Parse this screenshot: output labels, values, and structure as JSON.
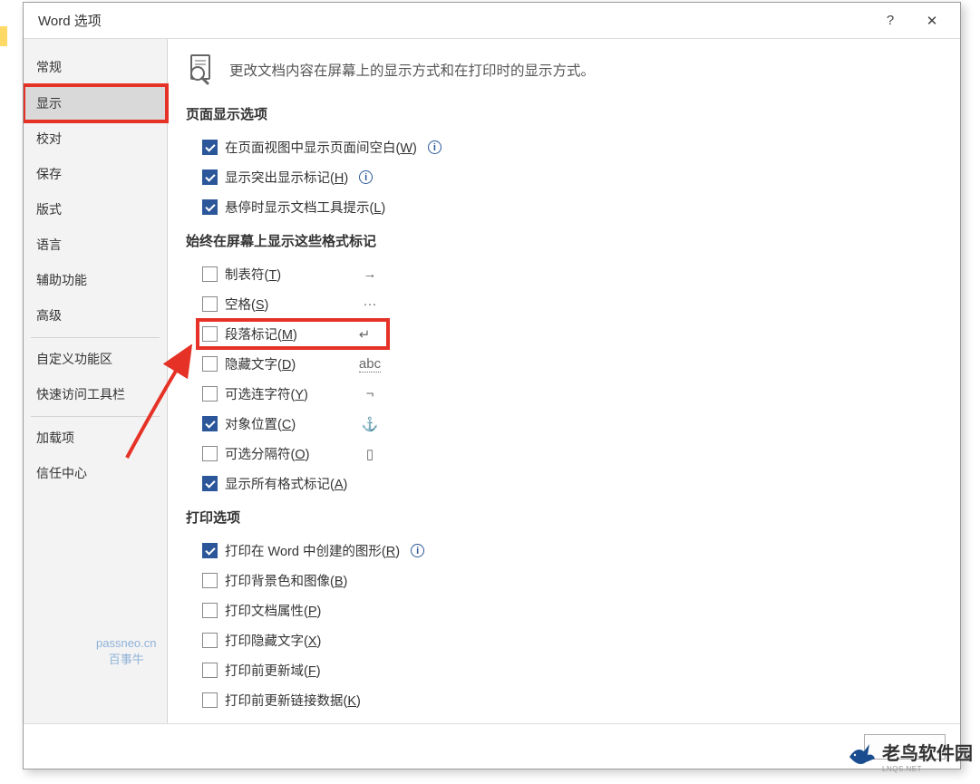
{
  "dialog": {
    "title": "Word 选项",
    "help_tooltip": "?",
    "close_tooltip": "✕"
  },
  "sidebar": {
    "items": [
      {
        "id": "general",
        "label": "常规"
      },
      {
        "id": "display",
        "label": "显示",
        "selected": true,
        "highlighted": true
      },
      {
        "id": "proofing",
        "label": "校对"
      },
      {
        "id": "save",
        "label": "保存"
      },
      {
        "id": "layout",
        "label": "版式"
      },
      {
        "id": "language",
        "label": "语言"
      },
      {
        "id": "accessibility",
        "label": "辅助功能"
      },
      {
        "id": "advanced",
        "label": "高级"
      },
      {
        "id": "customize-ribbon",
        "label": "自定义功能区"
      },
      {
        "id": "quick-access",
        "label": "快速访问工具栏"
      },
      {
        "id": "addins",
        "label": "加载项"
      },
      {
        "id": "trust-center",
        "label": "信任中心"
      }
    ]
  },
  "header": {
    "description": "更改文档内容在屏幕上的显示方式和在打印时的显示方式。"
  },
  "sections": {
    "page_display": {
      "title": "页面显示选项",
      "options": [
        {
          "id": "white-space",
          "label_pre": "在页面视图中显示页面间空白(",
          "hotkey": "W",
          "label_post": ")",
          "checked": true,
          "info": true
        },
        {
          "id": "highlighter",
          "label_pre": "显示突出显示标记(",
          "hotkey": "H",
          "label_post": ")",
          "checked": true,
          "info": true
        },
        {
          "id": "tooltips",
          "label_pre": "悬停时显示文档工具提示(",
          "hotkey": "L",
          "label_post": ")",
          "checked": true,
          "info": false
        }
      ]
    },
    "formatting_marks": {
      "title": "始终在屏幕上显示这些格式标记",
      "options": [
        {
          "id": "tabs",
          "label_pre": "制表符(",
          "hotkey": "T",
          "label_post": ")",
          "checked": false,
          "symbol": "→"
        },
        {
          "id": "spaces",
          "label_pre": "空格(",
          "hotkey": "S",
          "label_post": ")",
          "checked": false,
          "symbol": "···"
        },
        {
          "id": "paragraph",
          "label_pre": "段落标记(",
          "hotkey": "M",
          "label_post": ")",
          "checked": false,
          "symbol": "↵",
          "highlighted": true
        },
        {
          "id": "hidden-text",
          "label_pre": "隐藏文字(",
          "hotkey": "D",
          "label_post": ")",
          "checked": false,
          "symbol": "abc",
          "symbol_underline": true
        },
        {
          "id": "optional-hyphens",
          "label_pre": "可选连字符(",
          "hotkey": "Y",
          "label_post": ")",
          "checked": false,
          "symbol": "¬"
        },
        {
          "id": "object-anchors",
          "label_pre": "对象位置(",
          "hotkey": "C",
          "label_post": ")",
          "checked": true,
          "symbol": "⚓"
        },
        {
          "id": "optional-breaks",
          "label_pre": "可选分隔符(",
          "hotkey": "O",
          "label_post": ")",
          "checked": false,
          "symbol": "▯"
        },
        {
          "id": "show-all",
          "label_pre": "显示所有格式标记(",
          "hotkey": "A",
          "label_post": ")",
          "checked": true,
          "symbol": ""
        }
      ]
    },
    "printing": {
      "title": "打印选项",
      "options": [
        {
          "id": "drawings",
          "label_pre": "打印在 Word 中创建的图形(",
          "hotkey": "R",
          "label_post": ")",
          "checked": true,
          "info": true
        },
        {
          "id": "background",
          "label_pre": "打印背景色和图像(",
          "hotkey": "B",
          "label_post": ")",
          "checked": false
        },
        {
          "id": "properties",
          "label_pre": "打印文档属性(",
          "hotkey": "P",
          "label_post": ")",
          "checked": false
        },
        {
          "id": "hidden",
          "label_pre": "打印隐藏文字(",
          "hotkey": "X",
          "label_post": ")",
          "checked": false
        },
        {
          "id": "update-fields",
          "label_pre": "打印前更新域(",
          "hotkey": "F",
          "label_post": ")",
          "checked": false
        },
        {
          "id": "update-links",
          "label_pre": "打印前更新链接数据(",
          "hotkey": "K",
          "label_post": ")",
          "checked": false
        }
      ]
    }
  },
  "footer": {
    "ok": "",
    "cancel": ""
  },
  "watermarks": {
    "left_line1": "passneo.cn",
    "left_line2": "百事牛",
    "right_main": "老鸟软件园",
    "right_sub": "LNQS.NET"
  }
}
